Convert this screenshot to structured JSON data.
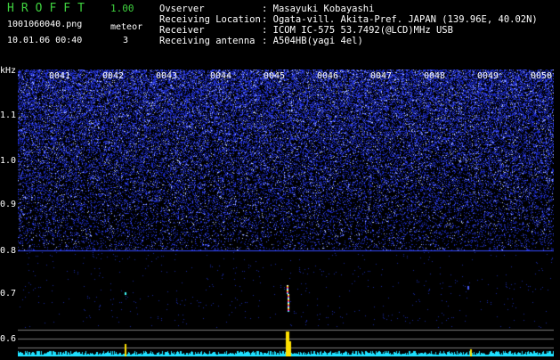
{
  "app": {
    "title": "HROFFT",
    "version": "1.00"
  },
  "file": {
    "name": "1001060040.png",
    "datetime": "10.01.06 00:40"
  },
  "meteor": {
    "label": "meteor",
    "count": "3"
  },
  "info": [
    {
      "label": "Ovserver",
      "value": ": Masayuki Kobayashi"
    },
    {
      "label": "Receiving Location",
      "value": ": Ogata-vill. Akita-Pref. JAPAN (139.96E, 40.02N)"
    },
    {
      "label": "Receiver",
      "value": ": ICOM IC-575 53.7492(@LCD)MHz USB"
    },
    {
      "label": "Receiving antenna",
      "value": ": A504HB(yagi 4el)"
    }
  ],
  "yaxis": {
    "unit": "kHz",
    "ticks": [
      "1.1",
      "1.0",
      "0.9",
      "0.8",
      "0.7",
      "0.6"
    ]
  },
  "xaxis": {
    "ticks": [
      "0041",
      "0042",
      "0043",
      "0044",
      "0045",
      "0046",
      "0047",
      "0048",
      "0049",
      "0050"
    ]
  },
  "colors": {
    "background": "#000000",
    "noise": "#2a3cff",
    "title": "#3fd23f",
    "baseline": "#1ee0ff",
    "meteor": "#ffe000"
  }
}
